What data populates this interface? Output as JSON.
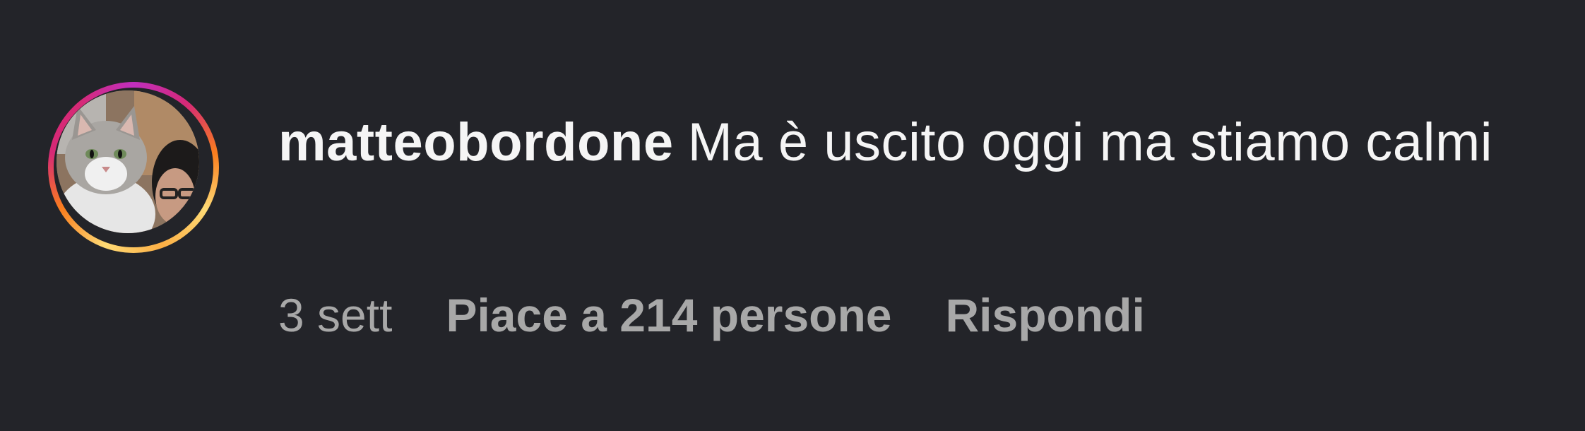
{
  "comment": {
    "username": "matteobordone",
    "text": "Ma è uscito oggi ma stiamo calmi",
    "time": "3 sett",
    "likes_label": "Piace a 214 persone",
    "reply_label": "Rispondi",
    "avatar_icon": "user-avatar-cat-photo"
  },
  "colors": {
    "background": "#232429",
    "primary_text": "#f5f5f5",
    "secondary_text": "#a8a8a8",
    "story_ring": [
      "#feda75",
      "#fa7e1e",
      "#d62976",
      "#c02fbf"
    ]
  }
}
